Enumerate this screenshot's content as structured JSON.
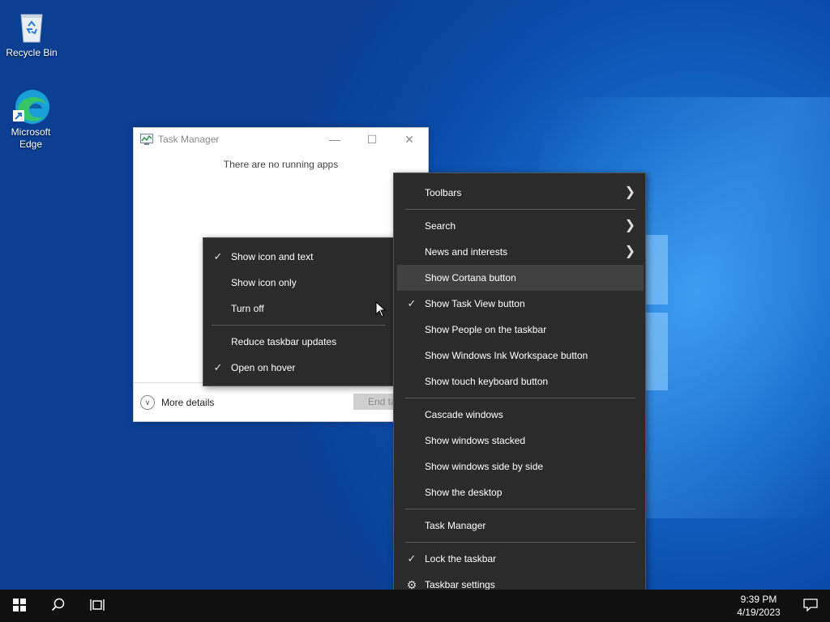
{
  "desktop": {
    "icons": [
      {
        "label": "Recycle Bin",
        "icon": "recycle-bin-icon"
      },
      {
        "label": "Microsoft Edge",
        "icon": "edge-icon"
      }
    ]
  },
  "task_manager": {
    "title": "Task Manager",
    "empty_message": "There are no running apps",
    "more_details": "More details",
    "end_task": "End task"
  },
  "submenu": {
    "items": [
      {
        "label": "Show icon and text",
        "checked": true
      },
      {
        "label": "Show icon only",
        "checked": false
      },
      {
        "label": "Turn off",
        "checked": false
      },
      {
        "label": "Reduce taskbar updates",
        "checked": false
      },
      {
        "label": "Open on hover",
        "checked": true
      }
    ]
  },
  "taskbar_menu": {
    "items": [
      {
        "label": "Toolbars",
        "submenu": true
      },
      {
        "label": "Search",
        "submenu": true
      },
      {
        "label": "News and interests",
        "submenu": true
      },
      {
        "label": "Show Cortana button",
        "highlighted": true
      },
      {
        "label": "Show Task View button",
        "checked": true
      },
      {
        "label": "Show People on the taskbar"
      },
      {
        "label": "Show Windows Ink Workspace button"
      },
      {
        "label": "Show touch keyboard button"
      },
      {
        "label": "Cascade windows"
      },
      {
        "label": "Show windows stacked"
      },
      {
        "label": "Show windows side by side"
      },
      {
        "label": "Show the desktop"
      },
      {
        "label": "Task Manager"
      },
      {
        "label": "Lock the taskbar",
        "checked": true
      },
      {
        "label": "Taskbar settings",
        "icon": "gear-icon"
      }
    ]
  },
  "taskbar": {
    "time": "9:39 PM",
    "date": "4/19/2023",
    "accent": "#101010"
  }
}
